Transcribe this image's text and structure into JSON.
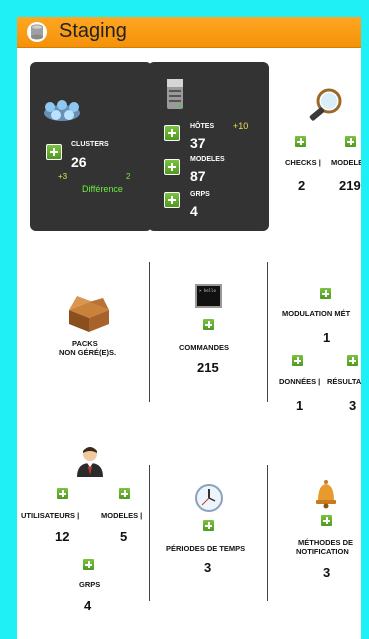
{
  "header": {
    "title": "Staging",
    "accent": "#f49208",
    "icon": "database-icon"
  },
  "clusters": {
    "label": "CLUSTERS",
    "count": "26",
    "delta_left": "+3",
    "delta_right": "2",
    "diff_label": "Différence"
  },
  "hosts": {
    "label": "HÔTES",
    "count": "37",
    "delta": "+10",
    "models_label": "MODELES",
    "models_count": "87",
    "groups_label": "GRPS",
    "groups_count": "4"
  },
  "checks": {
    "checks_label": "CHECKS |",
    "checks_count": "2",
    "models_label": "MODELE",
    "models_count": "219"
  },
  "packs": {
    "line1": "PACKS",
    "line2": "NON GÉRÉ(E)S."
  },
  "commands": {
    "label": "COMMANDES",
    "count": "215",
    "terminal_text": "> hello"
  },
  "modulation": {
    "label": "MODULATION MÉT",
    "count": "1",
    "data_label": "DONNÉES |",
    "data_count": "1",
    "results_label": "RÉSULTA",
    "results_count": "3"
  },
  "users": {
    "users_label": "UTILISATEURS |",
    "users_count": "12",
    "models_label": "MODELES |",
    "models_count": "5",
    "groups_label": "GRPS",
    "groups_count": "4"
  },
  "timeperiods": {
    "label": "PÉRIODES DE TEMPS",
    "count": "3"
  },
  "notification": {
    "line1": "MÉTHODES DE",
    "line2": "NOTIFICATION",
    "count": "3"
  }
}
